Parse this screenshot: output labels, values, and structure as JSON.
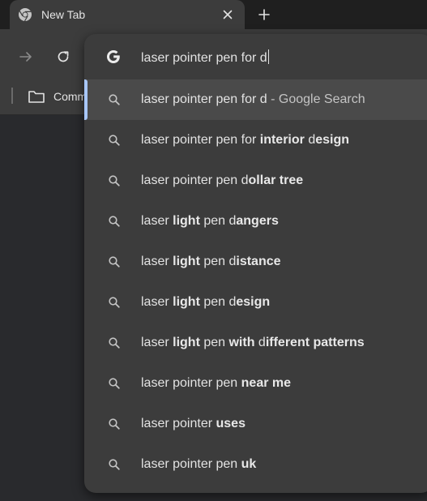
{
  "tab": {
    "title": "New Tab",
    "favicon": "chrome-icon",
    "close_icon": "close-icon"
  },
  "new_tab_icon": "plus-icon",
  "toolbar": {
    "forward_icon": "arrow-right-icon",
    "reload_icon": "reload-icon"
  },
  "bookmarks": {
    "folder_icon": "folder-icon",
    "folder_label": "Comm"
  },
  "omnibox": {
    "engine_icon": "google-g-icon",
    "input_value": "laser pointer pen for d",
    "suggestions": [
      {
        "parts": [
          {
            "t": "laser pointer pen for d",
            "b": false
          },
          {
            "t": " - Google Search",
            "b": false,
            "dim": true
          }
        ],
        "selected": true
      },
      {
        "parts": [
          {
            "t": "laser pointer pen for ",
            "b": false
          },
          {
            "t": "interior",
            "b": true
          },
          {
            "t": " d",
            "b": false
          },
          {
            "t": "esign",
            "b": true
          }
        ]
      },
      {
        "parts": [
          {
            "t": "laser pointer pen d",
            "b": false
          },
          {
            "t": "ollar tree",
            "b": true
          }
        ]
      },
      {
        "parts": [
          {
            "t": "laser ",
            "b": false
          },
          {
            "t": "light",
            "b": true
          },
          {
            "t": " pen d",
            "b": false
          },
          {
            "t": "angers",
            "b": true
          }
        ]
      },
      {
        "parts": [
          {
            "t": "laser ",
            "b": false
          },
          {
            "t": "light",
            "b": true
          },
          {
            "t": " pen d",
            "b": false
          },
          {
            "t": "istance",
            "b": true
          }
        ]
      },
      {
        "parts": [
          {
            "t": "laser ",
            "b": false
          },
          {
            "t": "light",
            "b": true
          },
          {
            "t": " pen d",
            "b": false
          },
          {
            "t": "esign",
            "b": true
          }
        ]
      },
      {
        "parts": [
          {
            "t": "laser ",
            "b": false
          },
          {
            "t": "light",
            "b": true
          },
          {
            "t": " pen ",
            "b": false
          },
          {
            "t": "with",
            "b": true
          },
          {
            "t": " d",
            "b": false
          },
          {
            "t": "ifferent patterns",
            "b": true
          }
        ]
      },
      {
        "parts": [
          {
            "t": "laser pointer pen ",
            "b": false
          },
          {
            "t": "near me",
            "b": true
          }
        ]
      },
      {
        "parts": [
          {
            "t": "laser pointer ",
            "b": false
          },
          {
            "t": "uses",
            "b": true
          }
        ]
      },
      {
        "parts": [
          {
            "t": "laser pointer pen ",
            "b": false
          },
          {
            "t": "uk",
            "b": true
          }
        ]
      }
    ],
    "suggestion_icon": "search-icon"
  },
  "colors": {
    "background": "#292a2d",
    "toolbar": "#3c3c3c",
    "popup": "#3c3c3c",
    "selected_row": "#4a4a4a",
    "accent": "#a8c7fa"
  }
}
